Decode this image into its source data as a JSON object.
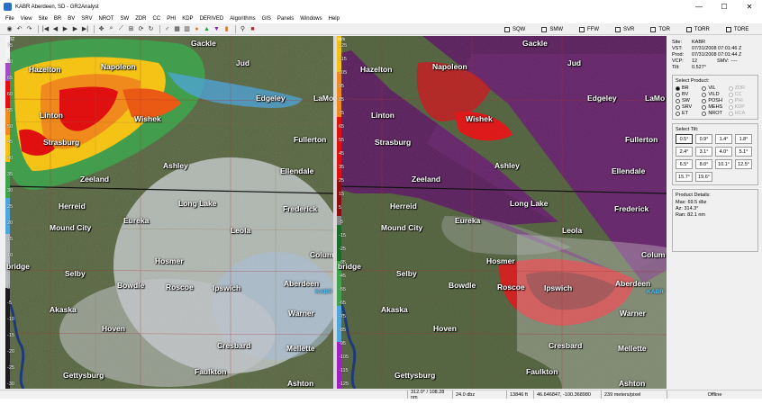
{
  "window": {
    "title": "KABR Aberdeen, SD - GR2Analyst",
    "minimize": "—",
    "maximize": "☐",
    "close": "✕"
  },
  "menu": [
    "File",
    "View",
    "Site",
    "BR",
    "BV",
    "SRV",
    "NROT",
    "SW",
    "ZDR",
    "CC",
    "PHI",
    "KDP",
    "DERIVED",
    "Algorithms",
    "GIS",
    "Panels",
    "Windows",
    "Help"
  ],
  "alerts": [
    "SQW",
    "SMW",
    "FFW",
    "SVR",
    "TOR",
    "TORR",
    "TORE"
  ],
  "left_scale": {
    "unit": "dBZ",
    "ticks": [
      "75",
      "70",
      "65",
      "60",
      "55",
      "50",
      "45",
      "40",
      "35",
      "30",
      "25",
      "20",
      "15",
      "10",
      "5",
      "0",
      "-5",
      "-10",
      "-15",
      "-20",
      "-25",
      "-30"
    ]
  },
  "right_scale": {
    "unit": "m/s",
    "ticks": [
      "125",
      "115",
      "105",
      "95",
      "85",
      "75",
      "65",
      "55",
      "45",
      "35",
      "25",
      "15",
      "5",
      "-5",
      "-15",
      "-25",
      "-35",
      "-45",
      "-55",
      "-65",
      "-75",
      "-85",
      "-95",
      "-105",
      "-115",
      "-125"
    ]
  },
  "towns": [
    {
      "name": "Gackle",
      "key": "gackle"
    },
    {
      "name": "Hazelton",
      "key": "hazelton"
    },
    {
      "name": "Napoleon",
      "key": "napoleon"
    },
    {
      "name": "Jud",
      "key": "jud"
    },
    {
      "name": "Edgeley",
      "key": "edgeley"
    },
    {
      "name": "LaMo",
      "key": "lamoure"
    },
    {
      "name": "Linton",
      "key": "linton"
    },
    {
      "name": "Wishek",
      "key": "wishek"
    },
    {
      "name": "Fullerton",
      "key": "fullerton"
    },
    {
      "name": "Strasburg",
      "key": "strasburg"
    },
    {
      "name": "Ashley",
      "key": "ashley"
    },
    {
      "name": "Ellendale",
      "key": "ellendale"
    },
    {
      "name": "Zeeland",
      "key": "zeeland"
    },
    {
      "name": "Herreid",
      "key": "herreid"
    },
    {
      "name": "Long Lake",
      "key": "longlake"
    },
    {
      "name": "Frederick",
      "key": "frederick"
    },
    {
      "name": "Eureka",
      "key": "eureka"
    },
    {
      "name": "Mound City",
      "key": "moundcity"
    },
    {
      "name": "Leola",
      "key": "leola"
    },
    {
      "name": "Colum",
      "key": "columbia"
    },
    {
      "name": "bridge",
      "key": "mobridge"
    },
    {
      "name": "Hosmer",
      "key": "hosmer"
    },
    {
      "name": "Selby",
      "key": "selby"
    },
    {
      "name": "Bowdle",
      "key": "bowdle"
    },
    {
      "name": "Roscoe",
      "key": "roscoe"
    },
    {
      "name": "Ipswich",
      "key": "ipswich"
    },
    {
      "name": "Aberdeen",
      "key": "aberdeen"
    },
    {
      "name": "Akaska",
      "key": "akaska"
    },
    {
      "name": "Warner",
      "key": "warner"
    },
    {
      "name": "Hoven",
      "key": "hoven"
    },
    {
      "name": "Cresbard",
      "key": "cresbard"
    },
    {
      "name": "Mellette",
      "key": "mellette"
    },
    {
      "name": "Gettysburg",
      "key": "gettysburg"
    },
    {
      "name": "Faulkton",
      "key": "faulkton"
    },
    {
      "name": "Ashton",
      "key": "ashton"
    }
  ],
  "radar_label": "KABR",
  "site_info": {
    "site_label": "Site:",
    "site": "KABR",
    "vst_label": "VST:",
    "vst": "07/31/2008  07:01:46 Z",
    "prod_label": "Prod:",
    "prod": "07/31/2008  07:01:44 Z",
    "vcp_label": "VCP:",
    "vcp": "12",
    "smv_label": "SMV:",
    "smv": "----",
    "tilt_label": "Tilt:",
    "tilt": "0.527°"
  },
  "select_product": {
    "title": "Select Product:",
    "items": [
      {
        "label": "BR",
        "selected": true,
        "enabled": true
      },
      {
        "label": "VIL",
        "selected": false,
        "enabled": true
      },
      {
        "label": "ZDR",
        "selected": false,
        "enabled": false
      },
      {
        "label": "BV",
        "selected": false,
        "enabled": true
      },
      {
        "label": "VILD",
        "selected": false,
        "enabled": true
      },
      {
        "label": "CC",
        "selected": false,
        "enabled": false
      },
      {
        "label": "SW",
        "selected": false,
        "enabled": true
      },
      {
        "label": "POSH",
        "selected": false,
        "enabled": true
      },
      {
        "label": "PHI",
        "selected": false,
        "enabled": false
      },
      {
        "label": "SRV",
        "selected": false,
        "enabled": true
      },
      {
        "label": "MEHS",
        "selected": false,
        "enabled": true
      },
      {
        "label": "KDP",
        "selected": false,
        "enabled": false
      },
      {
        "label": "ET",
        "selected": false,
        "enabled": true
      },
      {
        "label": "NROT",
        "selected": false,
        "enabled": true
      },
      {
        "label": "HCA",
        "selected": false,
        "enabled": false
      }
    ]
  },
  "select_tilt": {
    "title": "Select Tilt:",
    "tilts": [
      "0.5°",
      "0.9°",
      "1.4°",
      "1.8°",
      "2.4°",
      "3.1°",
      "4.0°",
      "5.1°",
      "6.5°",
      "8.0°",
      "10.1°",
      "12.5°",
      "15.7°",
      "19.6°"
    ],
    "selected": "0.5°"
  },
  "product_details": {
    "title": "Product Details:",
    "max": "Max:  69.5 dbz",
    "az": "Az:  314.3°",
    "ran": "Ran:  82.1 nm"
  },
  "status": {
    "azran": "312.0° / 108.28 nm",
    "value": "24.0 dbz",
    "height": "13846 ft",
    "coords": "46.646847, -100.368980",
    "resolution": "239 meters/pixel",
    "mode": "Offline"
  },
  "colors": {
    "terrain": "#4f5e3a",
    "reflectivity_high": "#e01010",
    "reflectivity_mid": "#f4c316",
    "reflectivity_low": "#3fa34d",
    "velocity_inbound": "#5a1a5e",
    "velocity_outbound": "#d11a1a",
    "radar_label": "#4ec6ff"
  }
}
